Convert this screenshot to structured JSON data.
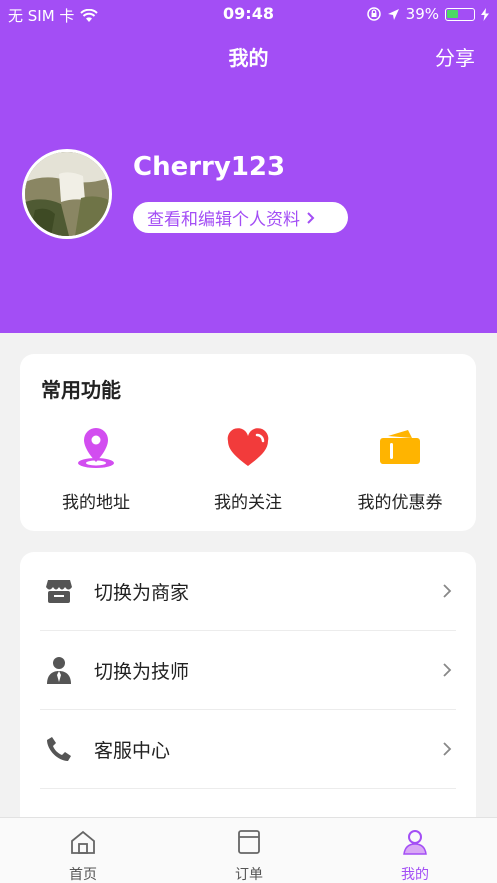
{
  "status_bar": {
    "carrier": "无 SIM 卡",
    "time": "09:48",
    "battery": "39%",
    "battery_level": 0.39
  },
  "nav": {
    "title": "我的",
    "share_label": "分享"
  },
  "profile": {
    "username": "Cherry123",
    "edit_label": "查看和编辑个人资料"
  },
  "functions": {
    "title": "常用功能",
    "items": [
      {
        "label": "我的地址",
        "icon": "location-pin-icon"
      },
      {
        "label": "我的关注",
        "icon": "heart-icon"
      },
      {
        "label": "我的优惠券",
        "icon": "coupon-icon"
      }
    ]
  },
  "menu": {
    "items": [
      {
        "label": "切换为商家",
        "icon": "store-icon"
      },
      {
        "label": "切换为技师",
        "icon": "person-icon"
      },
      {
        "label": "客服中心",
        "icon": "phone-icon"
      }
    ]
  },
  "tabbar": {
    "items": [
      {
        "label": "首页",
        "icon": "home-icon"
      },
      {
        "label": "订单",
        "icon": "order-icon"
      },
      {
        "label": "我的",
        "icon": "profile-icon"
      }
    ],
    "active_index": 2
  },
  "colors": {
    "brand": "#a34ef5",
    "heart": "#f23b3b",
    "coupon": "#ffb400",
    "location": "#d24df0"
  }
}
